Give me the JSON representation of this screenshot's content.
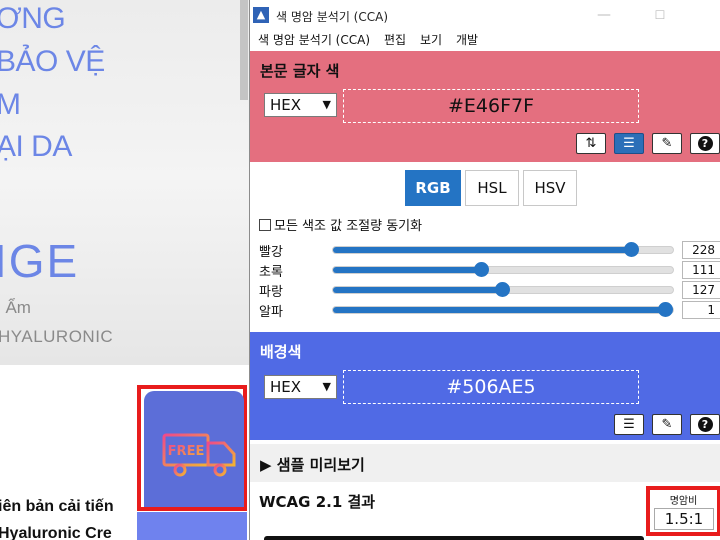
{
  "background_page": {
    "hero_lines": [
      "ƠNG",
      "BẢO VỆ",
      "M",
      "ẠI DA"
    ],
    "hero_big": "IGE",
    "hero_sub1": "ı Ẩm",
    "hero_sub2": "HYALURONIC",
    "free_label": "FREE",
    "text_line1": "iên bản cải tiến",
    "text_line2": "Hyaluronic Cre"
  },
  "window": {
    "title": "색 명암 분석기 (CCA)",
    "min_symbol": "—",
    "max_symbol": "☐"
  },
  "menu": [
    "색 명암 분석기 (CCA)",
    "편집",
    "보기",
    "개발"
  ],
  "foreground": {
    "title": "본문 글자 색",
    "format": "HEX",
    "hex": "#E46F7F",
    "color": "#E46F7F",
    "buttons": {
      "swap": "⇅",
      "adjust": "☰",
      "picker": "✎",
      "help": "?"
    }
  },
  "mode_tabs": [
    "RGB",
    "HSL",
    "HSV"
  ],
  "active_mode": "RGB",
  "sync_label": "모든 색조 값 조절량 동기화",
  "sliders": [
    {
      "label": "빨강",
      "value": "228",
      "fraction": 0.894
    },
    {
      "label": "초록",
      "value": "111",
      "fraction": 0.435
    },
    {
      "label": "파랑",
      "value": "127",
      "fraction": 0.498
    },
    {
      "label": "알파",
      "value": "1",
      "fraction": 1.0
    }
  ],
  "background": {
    "title": "배경색",
    "format": "HEX",
    "hex": "#506AE5",
    "color": "#506AE5",
    "buttons": {
      "adjust": "☰",
      "picker": "✎",
      "help": "?"
    }
  },
  "preview": {
    "toggle": "▶",
    "label": "샘플 미리보기"
  },
  "wcag": {
    "title": "WCAG 2.1 결과",
    "ratio_label": "명암비",
    "ratio_value": "1.5:1"
  }
}
